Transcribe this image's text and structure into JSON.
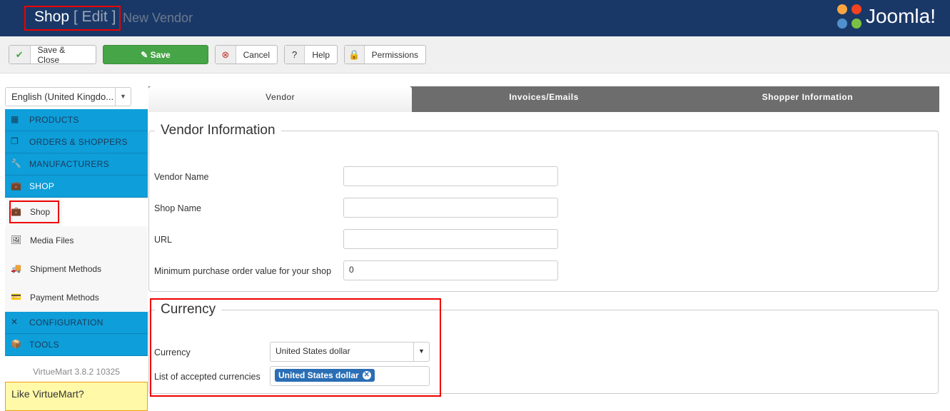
{
  "header": {
    "title": "Shop",
    "edit": "[ Edit ]",
    "subtitle": "New Vendor",
    "logo": "Joomla!"
  },
  "toolbar": {
    "save_close": "Save & Close",
    "save": "Save",
    "cancel": "Cancel",
    "help": "Help",
    "permissions": "Permissions"
  },
  "language": {
    "selected": "English (United Kingdo..."
  },
  "sidebar": {
    "sections": [
      {
        "label": "PRODUCTS"
      },
      {
        "label": "ORDERS & SHOPPERS"
      },
      {
        "label": "MANUFACTURERS"
      },
      {
        "label": "SHOP"
      },
      {
        "label": "CONFIGURATION"
      },
      {
        "label": "TOOLS"
      }
    ],
    "shop_items": [
      {
        "label": "Shop"
      },
      {
        "label": "Media Files"
      },
      {
        "label": "Shipment Methods"
      },
      {
        "label": "Payment Methods"
      }
    ],
    "version": "VirtueMart 3.8.2 10325",
    "like": "Like VirtueMart?"
  },
  "tabs": [
    {
      "label": "Vendor"
    },
    {
      "label": "Invoices/Emails"
    },
    {
      "label": "Shopper Information"
    }
  ],
  "vendor": {
    "legend": "Vendor Information",
    "vendor_name": {
      "label": "Vendor Name",
      "value": ""
    },
    "shop_name": {
      "label": "Shop Name",
      "value": ""
    },
    "url": {
      "label": "URL",
      "value": ""
    },
    "min_order": {
      "label": "Minimum purchase order value for your shop",
      "value": "0"
    }
  },
  "currency": {
    "legend": "Currency",
    "currency_label": "Currency",
    "currency_value": "United States dollar",
    "accepted_label": "List of accepted currencies",
    "accepted": [
      "United States dollar"
    ]
  },
  "colors": {
    "header": "#1a3867",
    "sidebar": "#0e9ed9",
    "save": "#46a546",
    "highlight": "#ee0000"
  }
}
